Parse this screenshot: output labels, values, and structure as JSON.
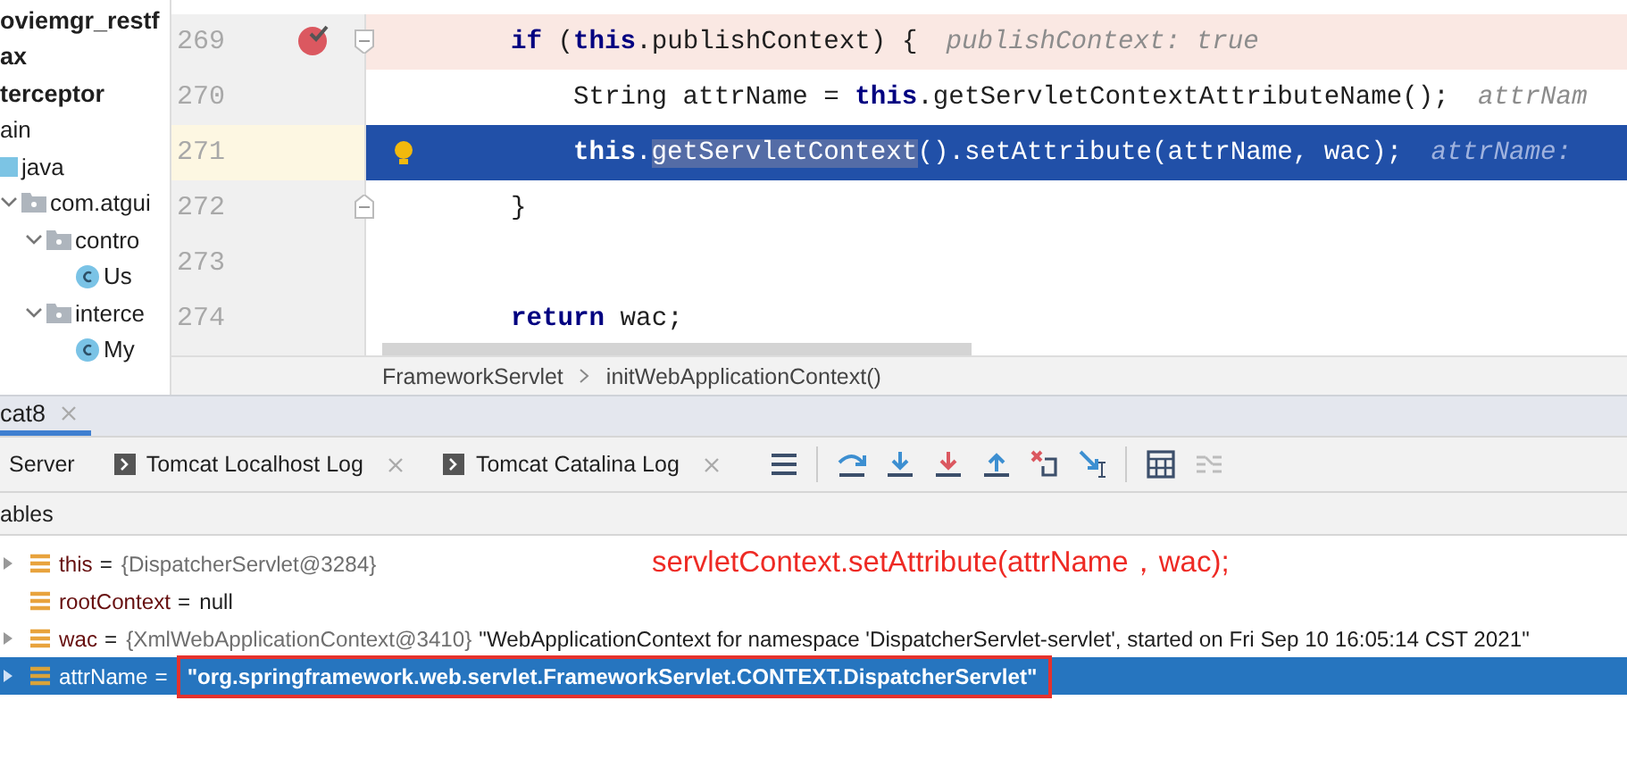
{
  "project_tree": [
    {
      "label": "oviemgr_restf",
      "kind": "module"
    },
    {
      "label": "ax",
      "kind": "module"
    },
    {
      "label": "terceptor",
      "kind": "module"
    },
    {
      "label": "ain",
      "kind": "folder",
      "children": [
        {
          "label": "java",
          "kind": "source-folder",
          "children": [
            {
              "label": "com.atgui",
              "kind": "package",
              "expanded": true,
              "children": [
                {
                  "label": "contro",
                  "kind": "package",
                  "expanded": true,
                  "children": [
                    {
                      "label": "Us",
                      "kind": "class"
                    }
                  ]
                },
                {
                  "label": "interce",
                  "kind": "package",
                  "expanded": true,
                  "children": [
                    {
                      "label": "My",
                      "kind": "class"
                    }
                  ]
                }
              ]
            }
          ]
        }
      ]
    }
  ],
  "editor": {
    "lines": [
      {
        "number": "269",
        "breakpoint": true,
        "execution_point": false,
        "fold_start": true,
        "fold_end": false,
        "intention_bulb": false,
        "indented": false,
        "tokens": [
          {
            "text": "if",
            "kind": "keyword"
          },
          {
            "text": " (",
            "kind": "plain"
          },
          {
            "text": "this",
            "kind": "keyword"
          },
          {
            "text": ".publishContext) {",
            "kind": "plain"
          },
          {
            "text": "publishContext: true",
            "kind": "hint"
          }
        ]
      },
      {
        "number": "270",
        "breakpoint": false,
        "execution_point": false,
        "fold_start": false,
        "fold_end": false,
        "intention_bulb": false,
        "indented": true,
        "tokens": [
          {
            "text": "String attrName = ",
            "kind": "plain"
          },
          {
            "text": "this",
            "kind": "keyword"
          },
          {
            "text": ".getServletContextAttributeName();",
            "kind": "plain"
          },
          {
            "text": "attrNam",
            "kind": "hint"
          }
        ]
      },
      {
        "number": "271",
        "breakpoint": false,
        "execution_point": true,
        "fold_start": false,
        "fold_end": false,
        "intention_bulb": true,
        "indented": true,
        "tokens": [
          {
            "text": "this",
            "kind": "keyword"
          },
          {
            "text": ".",
            "kind": "plain"
          },
          {
            "text": "getServletContext",
            "kind": "usage"
          },
          {
            "text": "().setAttribute(attrName, wac);",
            "kind": "plain"
          },
          {
            "text": "attrName:",
            "kind": "hint"
          }
        ]
      },
      {
        "number": "272",
        "breakpoint": false,
        "execution_point": false,
        "fold_start": false,
        "fold_end": true,
        "intention_bulb": false,
        "indented": false,
        "tokens": [
          {
            "text": "}",
            "kind": "plain"
          }
        ]
      },
      {
        "number": "273",
        "breakpoint": false,
        "execution_point": false,
        "fold_start": false,
        "fold_end": false,
        "intention_bulb": false,
        "indented": false
      },
      {
        "number": "274",
        "breakpoint": false,
        "execution_point": false,
        "fold_start": false,
        "fold_end": false,
        "intention_bulb": false,
        "indented": false,
        "tokens": [
          {
            "text": "return",
            "kind": "keyword"
          },
          {
            "text": " wac;",
            "kind": "plain"
          }
        ]
      }
    ],
    "breadcrumbs": [
      "FrameworkServlet",
      "initWebApplicationContext()"
    ]
  },
  "debug_tabs": [
    {
      "label": "cat8",
      "selected": true
    }
  ],
  "toolbar": {
    "tabs": [
      {
        "label": "Server",
        "kind": "plain"
      },
      {
        "label": "Tomcat Localhost Log",
        "kind": "log"
      },
      {
        "label": "Tomcat Catalina Log",
        "kind": "log"
      }
    ],
    "buttons": [
      {
        "kind": "lines",
        "disabled": false
      },
      {
        "kind": "step-over",
        "disabled": false
      },
      {
        "kind": "step-into",
        "disabled": false
      },
      {
        "kind": "force-step-into",
        "disabled": false
      },
      {
        "kind": "step-out",
        "disabled": false
      },
      {
        "kind": "drop-frame",
        "disabled": false
      },
      {
        "kind": "run-to-cursor",
        "disabled": false
      },
      {
        "kind": "evaluate",
        "disabled": false
      },
      {
        "kind": "trace",
        "disabled": true
      }
    ]
  },
  "variables_panel": {
    "title": "ables",
    "variables": [
      {
        "name": "this",
        "operator": "=",
        "type": "{DispatcherServlet@3284}",
        "expandable": true,
        "selected": false,
        "annotated": false
      },
      {
        "name": "rootContext",
        "operator": "=",
        "value": "null",
        "expandable": false,
        "selected": false,
        "annotated": false
      },
      {
        "name": "wac",
        "operator": "=",
        "type": "{XmlWebApplicationContext@3410}",
        "value": "\"WebApplicationContext for namespace 'DispatcherServlet-servlet', started on Fri Sep 10 16:05:14 CST 2021\"",
        "expandable": true,
        "selected": false,
        "annotated": false
      },
      {
        "name": "attrName",
        "operator": "=",
        "value": "\"org.springframework.web.servlet.FrameworkServlet.CONTEXT.DispatcherServlet\"",
        "expandable": true,
        "selected": true,
        "annotated": true
      }
    ],
    "annotation": "servletContext.setAttribute(attrName，wac);"
  }
}
